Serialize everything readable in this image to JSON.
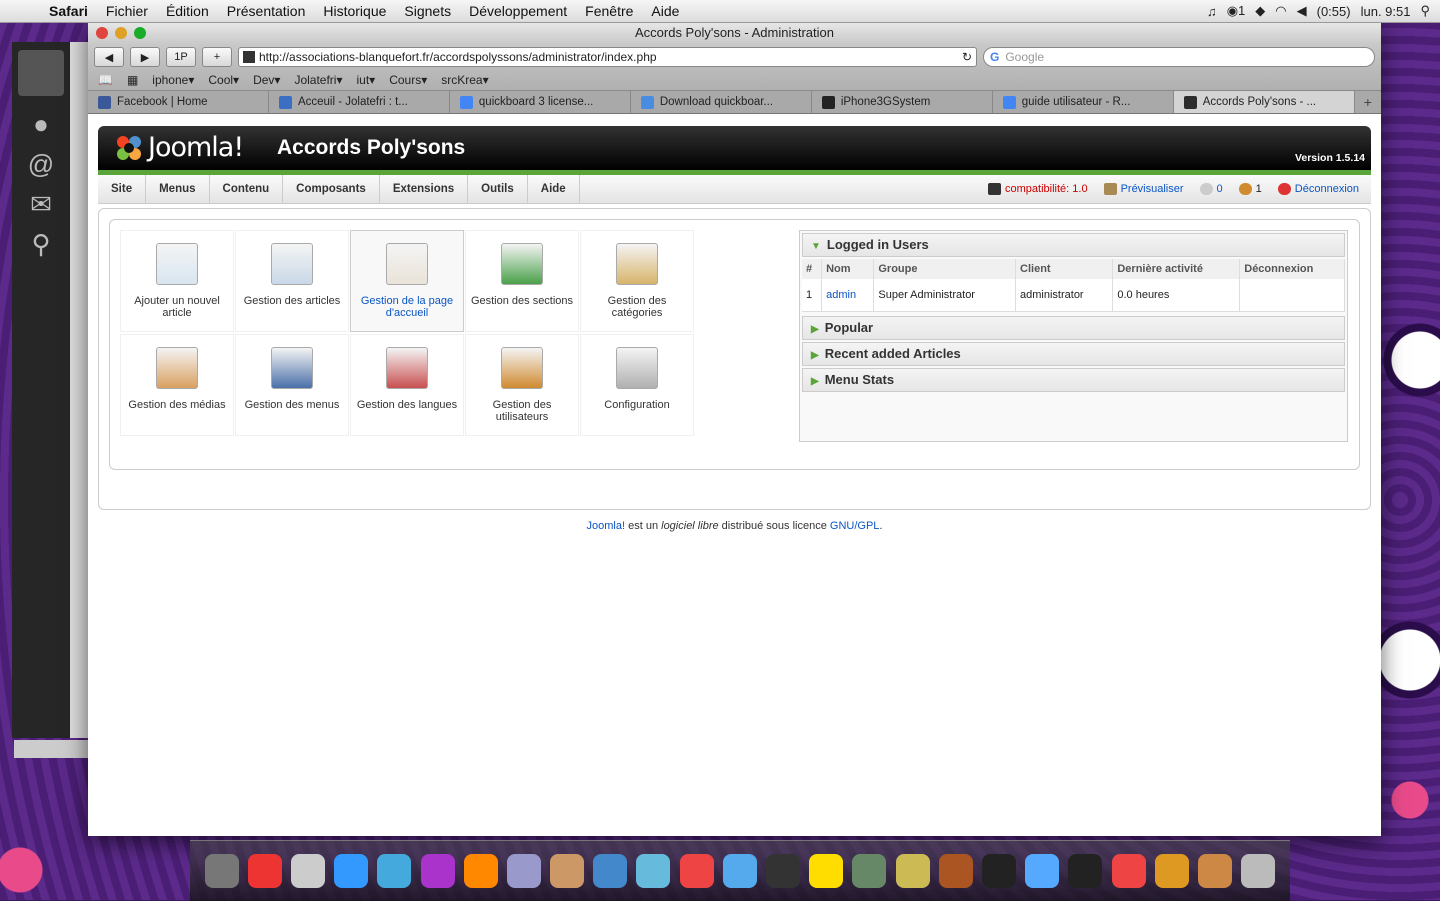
{
  "menubar": {
    "app": "Safari",
    "items": [
      "Fichier",
      "Édition",
      "Présentation",
      "Historique",
      "Signets",
      "Développement",
      "Fenêtre",
      "Aide"
    ],
    "battery": "(0:55)",
    "clock": "lun. 9:51",
    "notif_count": "1"
  },
  "window": {
    "title": "Accords Poly'sons - Administration",
    "url": "http://associations-blanquefort.fr/accordspolyssons/administrator/index.php",
    "search_placeholder": "Google",
    "onep": "1P"
  },
  "bookmarks": [
    "iphone▾",
    "Cool▾",
    "Dev▾",
    "Jolatefri▾",
    "iut▾",
    "Cours▾",
    "srcKrea▾"
  ],
  "tabs": [
    {
      "label": "Facebook | Home",
      "color": "#3b5998"
    },
    {
      "label": "Acceuil - Jolatefri : t...",
      "color": "#3a6fc4"
    },
    {
      "label": "quickboard 3 license...",
      "color": "#4285f4"
    },
    {
      "label": "Download quickboar...",
      "color": "#4a8de0"
    },
    {
      "label": "iPhone3GSystem",
      "color": "#222222"
    },
    {
      "label": "guide utilisateur - R...",
      "color": "#4285f4"
    },
    {
      "label": "Accords Poly'sons - ...",
      "color": "#2d2d2d"
    }
  ],
  "joomla": {
    "logo_text": "Joomla!",
    "site_name": "Accords Poly'sons",
    "version": "Version 1.5.14",
    "menu": [
      "Site",
      "Menus",
      "Contenu",
      "Composants",
      "Extensions",
      "Outils",
      "Aide"
    ],
    "status": {
      "compat": "compatibilité: 1.0",
      "preview": "Prévisualiser",
      "messages": "0",
      "users": "1",
      "logout": "Déconnexion"
    },
    "icons": [
      {
        "label": "Ajouter un nouvel article",
        "icon": "add-article-icon",
        "color": "#d8e6f0"
      },
      {
        "label": "Gestion des articles",
        "icon": "articles-icon",
        "color": "#c9d8e8"
      },
      {
        "label": "Gestion de la page d'accueil",
        "icon": "frontpage-icon",
        "color": "#e9e3d8"
      },
      {
        "label": "Gestion des sections",
        "icon": "sections-icon",
        "color": "#4aa04a"
      },
      {
        "label": "Gestion des catégories",
        "icon": "categories-icon",
        "color": "#d8b46a"
      },
      {
        "label": "Gestion des médias",
        "icon": "media-icon",
        "color": "#d9a060"
      },
      {
        "label": "Gestion des menus",
        "icon": "menus-icon",
        "color": "#4a6fa8"
      },
      {
        "label": "Gestion des langues",
        "icon": "languages-icon",
        "color": "#c85050"
      },
      {
        "label": "Gestion des utilisateurs",
        "icon": "users-icon",
        "color": "#d08a30"
      },
      {
        "label": "Configuration",
        "icon": "config-icon",
        "color": "#b0b0b0"
      }
    ],
    "modules": {
      "logged_title": "Logged in Users",
      "columns": [
        "#",
        "Nom",
        "Groupe",
        "Client",
        "Dernière activité",
        "Déconnexion"
      ],
      "rows": [
        [
          "1",
          "admin",
          "Super Administrator",
          "administrator",
          "0.0 heures",
          ""
        ]
      ],
      "collapsed": [
        "Popular",
        "Recent added Articles",
        "Menu Stats"
      ]
    },
    "footer": {
      "joomla": "Joomla!",
      "text1": " est un ",
      "libre": "logiciel libre",
      "text2": " distribué sous licence ",
      "license": "GNU/GPL",
      "dot": "."
    }
  }
}
